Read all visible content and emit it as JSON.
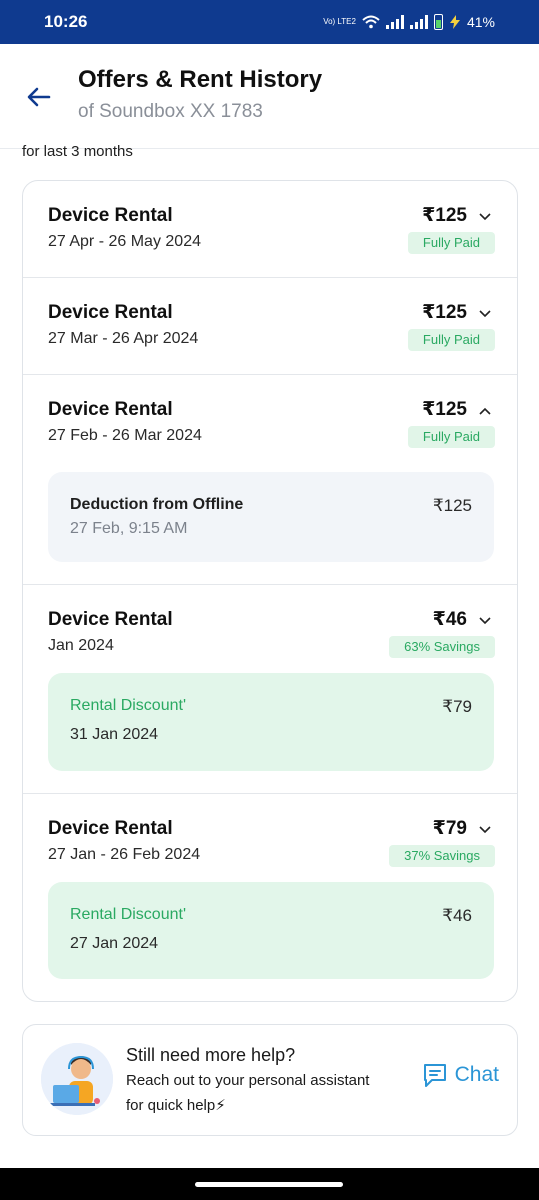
{
  "status_bar": {
    "time": "10:26",
    "volte": "Vo) LTE2",
    "battery": "41%"
  },
  "header": {
    "title": "Offers & Rent History",
    "subtitle": "of Soundbox XX 1783"
  },
  "cut_text": "for last 3 months",
  "rentals": [
    {
      "title": "Device Rental",
      "period": "27 Apr - 26 May 2024",
      "amount": "₹125",
      "badge": "Fully Paid",
      "expanded": false
    },
    {
      "title": "Device Rental",
      "period": "27 Mar - 26 Apr 2024",
      "amount": "₹125",
      "badge": "Fully Paid",
      "expanded": false
    },
    {
      "title": "Device Rental",
      "period": "27 Feb - 26 Mar 2024",
      "amount": "₹125",
      "badge": "Fully Paid",
      "expanded": true,
      "detail": {
        "title": "Deduction from Offline",
        "subtitle": "27 Feb, 9:15 AM",
        "amount": "₹125"
      }
    },
    {
      "title": "Device Rental",
      "period": "Jan 2024",
      "amount": "₹46",
      "badge": "63% Savings",
      "expanded": false,
      "detail": {
        "title": "Rental Discount'",
        "subtitle": "31 Jan 2024",
        "amount": "₹79"
      }
    },
    {
      "title": "Device Rental",
      "period": "27 Jan - 26 Feb 2024",
      "amount": "₹79",
      "badge": "37% Savings",
      "expanded": false,
      "detail": {
        "title": "Rental Discount'",
        "subtitle": "27 Jan 2024",
        "amount": "₹46"
      }
    }
  ],
  "help": {
    "title": "Still need more help?",
    "line1": "Reach out to your personal assistant",
    "line2": "for quick help⚡",
    "chat_label": "Chat"
  },
  "colors": {
    "status_bar": "#0f3a8f",
    "accent_green": "#2aa962",
    "chat_blue": "#2b95d6",
    "header_icon": "#0f3a8f"
  },
  "icons": {
    "back": "back-arrow-icon",
    "chevron_down": "chevron-down-icon",
    "chevron_up": "chevron-up-icon",
    "chat": "chat-bubble-icon",
    "wifi": "wifi-icon",
    "signal": "signal-icon",
    "battery": "battery-icon"
  }
}
